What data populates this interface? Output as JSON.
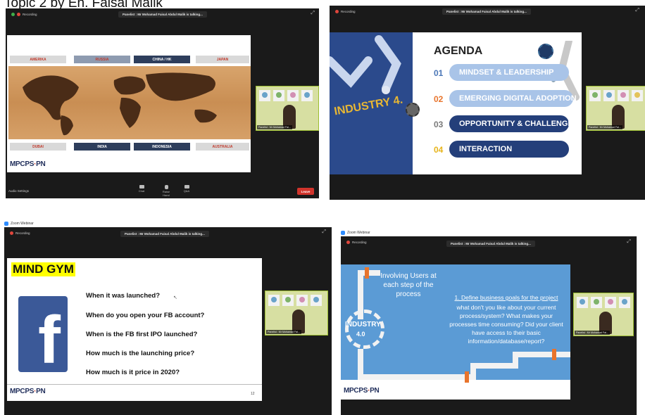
{
  "page": {
    "heading": "Topic 2 by En. Faisal Malik"
  },
  "window1": {
    "recording": "Recording",
    "speaker_banner": "Panelist : Mr Mohamad Faisal Abdul Malik is talking...",
    "countries_top": [
      "AMERIKA",
      "RUSSIA",
      "CHINA / HK",
      "JAPAN"
    ],
    "countries_bottom": [
      "DUBAI",
      "INDIA",
      "INDONESIA",
      "AUSTRALIA"
    ],
    "logo": {
      "mpc": "MPC",
      "ps": "PS",
      "pn": "PN"
    },
    "audio_settings": "Audio Settings",
    "controls": [
      "Chat",
      "Raise Hand",
      "Q&A"
    ],
    "leave": "Leave",
    "panelist_label": "Panelist : Mr Mohamad Fai..."
  },
  "window2": {
    "recording": "Recording",
    "speaker_banner": "Panelist : Mr Mohamad Faisal Abdul Malik is talking...",
    "industry_text": "INDUSTRY 4.",
    "agenda_title": "AGENDA",
    "items": [
      {
        "num": "01",
        "label": "MINDSET & LEADERSHIP",
        "color": "#a9c4e8",
        "num_color": "#4a76b7"
      },
      {
        "num": "02",
        "label": "EMERGING DIGITAL ADOPTION",
        "color": "#a9c4e8",
        "num_color": "#e8742c"
      },
      {
        "num": "03",
        "label": "OPPORTUNITY & CHALLENGES",
        "color": "#243f7a",
        "num_color": "#7a7a7a"
      },
      {
        "num": "04",
        "label": "INTERACTION",
        "color": "#243f7a",
        "num_color": "#e7b41a"
      }
    ],
    "panelist_label": "Panelist : Mr Mohamad Fai..."
  },
  "window3": {
    "zoom_title": "Zoom Webinar",
    "recording": "Recording",
    "speaker_banner": "Panelist : Mr Mohamad Faisal Abdul Malik is talking...",
    "mind_gym": "MIND GYM",
    "questions": [
      "When it was launched?",
      "When do you open your FB account?",
      "When is the FB first IPO launched?",
      "How much is the launching price?",
      "How much is it price in 2020?"
    ],
    "fb_letter": "f",
    "logo": {
      "mpc": "MPC",
      "ps": "PS",
      "pn": "PN"
    },
    "page_num": "12",
    "panelist_label": "Panelist : Mr Mohamad Fai..."
  },
  "window4": {
    "zoom_title": "Zoom Webinar",
    "recording": "Recording",
    "speaker_banner": "Panelist : Mr Mohamad Faisal Abdul Malik is talking...",
    "involving": "Involving Users at each step of the process",
    "industry": "INDUSTRY",
    "industry_num": "4.0",
    "step_title": "1. Define business goals for the project",
    "step_body": "what don't you like about your current process/system? What makes your processes time consuming? Did your client have access to their basic information/database/report?",
    "logo": {
      "mpc": "MPC",
      "ps": "PS",
      "pn": "PN"
    },
    "panelist_label": "Panelist : Mr Mohamad Fai..."
  }
}
